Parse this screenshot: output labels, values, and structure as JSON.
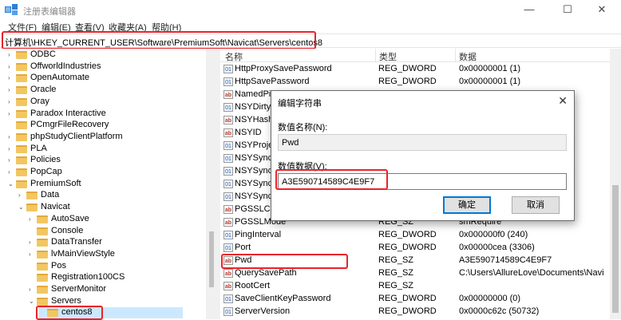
{
  "window": {
    "title": "注册表编辑器",
    "minimize": "—",
    "maximize": "☐",
    "close": "✕"
  },
  "menu": [
    "文件(F)",
    "编辑(E)",
    "查看(V)",
    "收藏夹(A)",
    "帮助(H)"
  ],
  "address": "计算机\\HKEY_CURRENT_USER\\Software\\PremiumSoft\\Navicat\\Servers\\centos8",
  "tree": {
    "items": [
      {
        "label": "ODBC",
        "tw": "›",
        "level": 0
      },
      {
        "label": "OffworldIndustries",
        "tw": "›",
        "level": 0
      },
      {
        "label": "OpenAutomate",
        "tw": "›",
        "level": 0
      },
      {
        "label": "Oracle",
        "tw": "›",
        "level": 0
      },
      {
        "label": "Oray",
        "tw": "›",
        "level": 0
      },
      {
        "label": "Paradox Interactive",
        "tw": "›",
        "level": 0
      },
      {
        "label": "PCmgrFileRecovery",
        "tw": "",
        "level": 0
      },
      {
        "label": "phpStudyClientPlatform",
        "tw": "›",
        "level": 0
      },
      {
        "label": "PLA",
        "tw": "›",
        "level": 0
      },
      {
        "label": "Policies",
        "tw": "›",
        "level": 0
      },
      {
        "label": "PopCap",
        "tw": "›",
        "level": 0
      },
      {
        "label": "PremiumSoft",
        "tw": "⌄",
        "level": 0
      },
      {
        "label": "Data",
        "tw": "›",
        "level": 1
      },
      {
        "label": "Navicat",
        "tw": "⌄",
        "level": 1
      },
      {
        "label": "AutoSave",
        "tw": "›",
        "level": 2
      },
      {
        "label": "Console",
        "tw": "",
        "level": 2
      },
      {
        "label": "DataTransfer",
        "tw": "›",
        "level": 2
      },
      {
        "label": "lvMainViewStyle",
        "tw": "›",
        "level": 2
      },
      {
        "label": "Pos",
        "tw": "",
        "level": 2
      },
      {
        "label": "Registration100CS",
        "tw": "",
        "level": 2
      },
      {
        "label": "ServerMonitor",
        "tw": "›",
        "level": 2
      },
      {
        "label": "Servers",
        "tw": "⌄",
        "level": 2
      },
      {
        "label": "centos8",
        "tw": "",
        "level": 3
      }
    ]
  },
  "list": {
    "headers": [
      "名称",
      "类型",
      "数据"
    ],
    "rows": [
      {
        "icon": "dw",
        "name": "HttpProxySavePassword",
        "type": "REG_DWORD",
        "data": "0x00000001 (1)"
      },
      {
        "icon": "dw",
        "name": "HttpSavePassword",
        "type": "REG_DWORD",
        "data": "0x00000001 (1)"
      },
      {
        "icon": "sz",
        "name": "NamedPi",
        "type": "",
        "data": ""
      },
      {
        "icon": "dw",
        "name": "NSYDirty",
        "type": "",
        "data": ""
      },
      {
        "icon": "sz",
        "name": "NSYHash",
        "type": "",
        "data": ""
      },
      {
        "icon": "sz",
        "name": "NSYID",
        "type": "",
        "data": ""
      },
      {
        "icon": "dw",
        "name": "NSYProje",
        "type": "",
        "data": ""
      },
      {
        "icon": "dw",
        "name": "NSYSync",
        "type": "",
        "data": ""
      },
      {
        "icon": "dw",
        "name": "NSYSync",
        "type": "",
        "data": ""
      },
      {
        "icon": "dw",
        "name": "NSYSync",
        "type": "",
        "data": ""
      },
      {
        "icon": "dw",
        "name": "NSYSync",
        "type": "",
        "data": ""
      },
      {
        "icon": "sz",
        "name": "PGSSLCR",
        "type": "",
        "data": ""
      },
      {
        "icon": "sz",
        "name": "PGSSLMode",
        "type": "REG_SZ",
        "data": "smRequire"
      },
      {
        "icon": "dw",
        "name": "PingInterval",
        "type": "REG_DWORD",
        "data": "0x000000f0 (240)"
      },
      {
        "icon": "dw",
        "name": "Port",
        "type": "REG_DWORD",
        "data": "0x00000cea (3306)"
      },
      {
        "icon": "sz",
        "name": "Pwd",
        "type": "REG_SZ",
        "data": "A3E590714589C4E9F7"
      },
      {
        "icon": "sz",
        "name": "QuerySavePath",
        "type": "REG_SZ",
        "data": "C:\\Users\\AllureLove\\Documents\\Navi"
      },
      {
        "icon": "sz",
        "name": "RootCert",
        "type": "REG_SZ",
        "data": ""
      },
      {
        "icon": "dw",
        "name": "SaveClientKeyPassword",
        "type": "REG_DWORD",
        "data": "0x00000000 (0)"
      },
      {
        "icon": "dw",
        "name": "ServerVersion",
        "type": "REG_DWORD",
        "data": "0x0000c62c (50732)"
      }
    ]
  },
  "dialog": {
    "title": "编辑字符串",
    "close": "✕",
    "name_label": "数值名称(N):",
    "name_value": "Pwd",
    "data_label": "数值数据(V):",
    "data_value": "A3E590714589C4E9F7",
    "ok": "确定",
    "cancel": "取消"
  },
  "colors": {
    "highlight": "#e8242a",
    "selection": "#cce8ff",
    "accent": "#0078d7"
  }
}
